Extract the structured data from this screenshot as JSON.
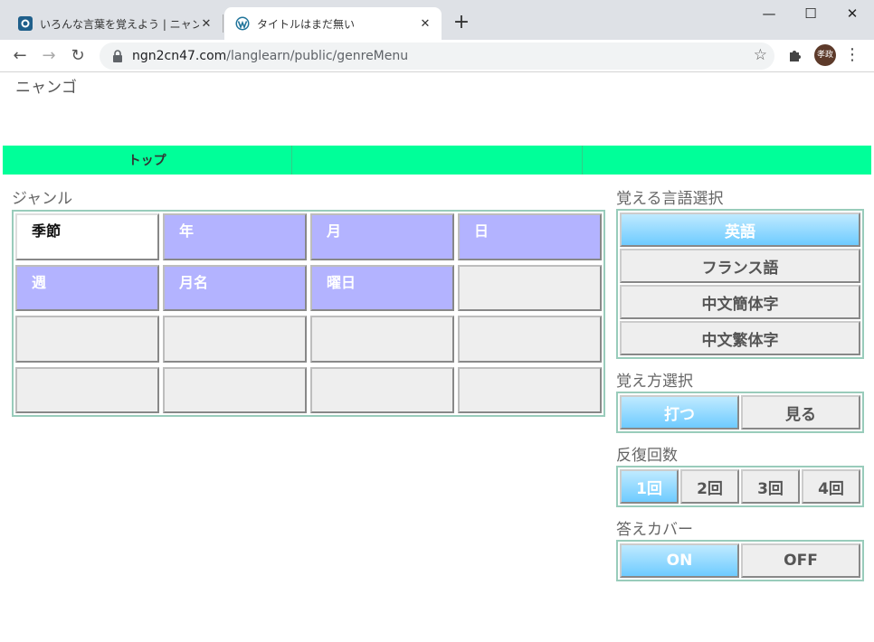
{
  "browser": {
    "tabs": [
      {
        "title": "いろんな言葉を覚えよう | ニャン語",
        "active": false
      },
      {
        "title": "タイトルはまだ無い",
        "active": true
      }
    ],
    "url_host": "ngn2cn47.com",
    "url_path": "/langlearn/public/genreMenu",
    "profile_initials": "孝政"
  },
  "site": {
    "title": "ニャンゴ",
    "nav": [
      "トップ",
      "",
      ""
    ]
  },
  "genre": {
    "label": "ジャンル",
    "cells": [
      {
        "text": "季節",
        "state": "selected"
      },
      {
        "text": "年",
        "state": "set"
      },
      {
        "text": "月",
        "state": "set"
      },
      {
        "text": "日",
        "state": "set"
      },
      {
        "text": "週",
        "state": "set"
      },
      {
        "text": "月名",
        "state": "set"
      },
      {
        "text": "曜日",
        "state": "set"
      },
      {
        "text": "",
        "state": "empty"
      },
      {
        "text": "",
        "state": "empty"
      },
      {
        "text": "",
        "state": "empty"
      },
      {
        "text": "",
        "state": "empty"
      },
      {
        "text": "",
        "state": "empty"
      },
      {
        "text": "",
        "state": "empty"
      },
      {
        "text": "",
        "state": "empty"
      },
      {
        "text": "",
        "state": "empty"
      },
      {
        "text": "",
        "state": "empty"
      }
    ]
  },
  "language_select": {
    "label": "覚える言語選択",
    "options": [
      "英語",
      "フランス語",
      "中文簡体字",
      "中文繁体字"
    ],
    "selected": 0
  },
  "method_select": {
    "label": "覚え方選択",
    "options": [
      "打つ",
      "見る"
    ],
    "selected": 0
  },
  "repeat_count": {
    "label": "反復回数",
    "options": [
      "1回",
      "2回",
      "3回",
      "4回"
    ],
    "selected": 0
  },
  "answer_cover": {
    "label": "答えカバー",
    "options": [
      "ON",
      "OFF"
    ],
    "selected": 0
  }
}
